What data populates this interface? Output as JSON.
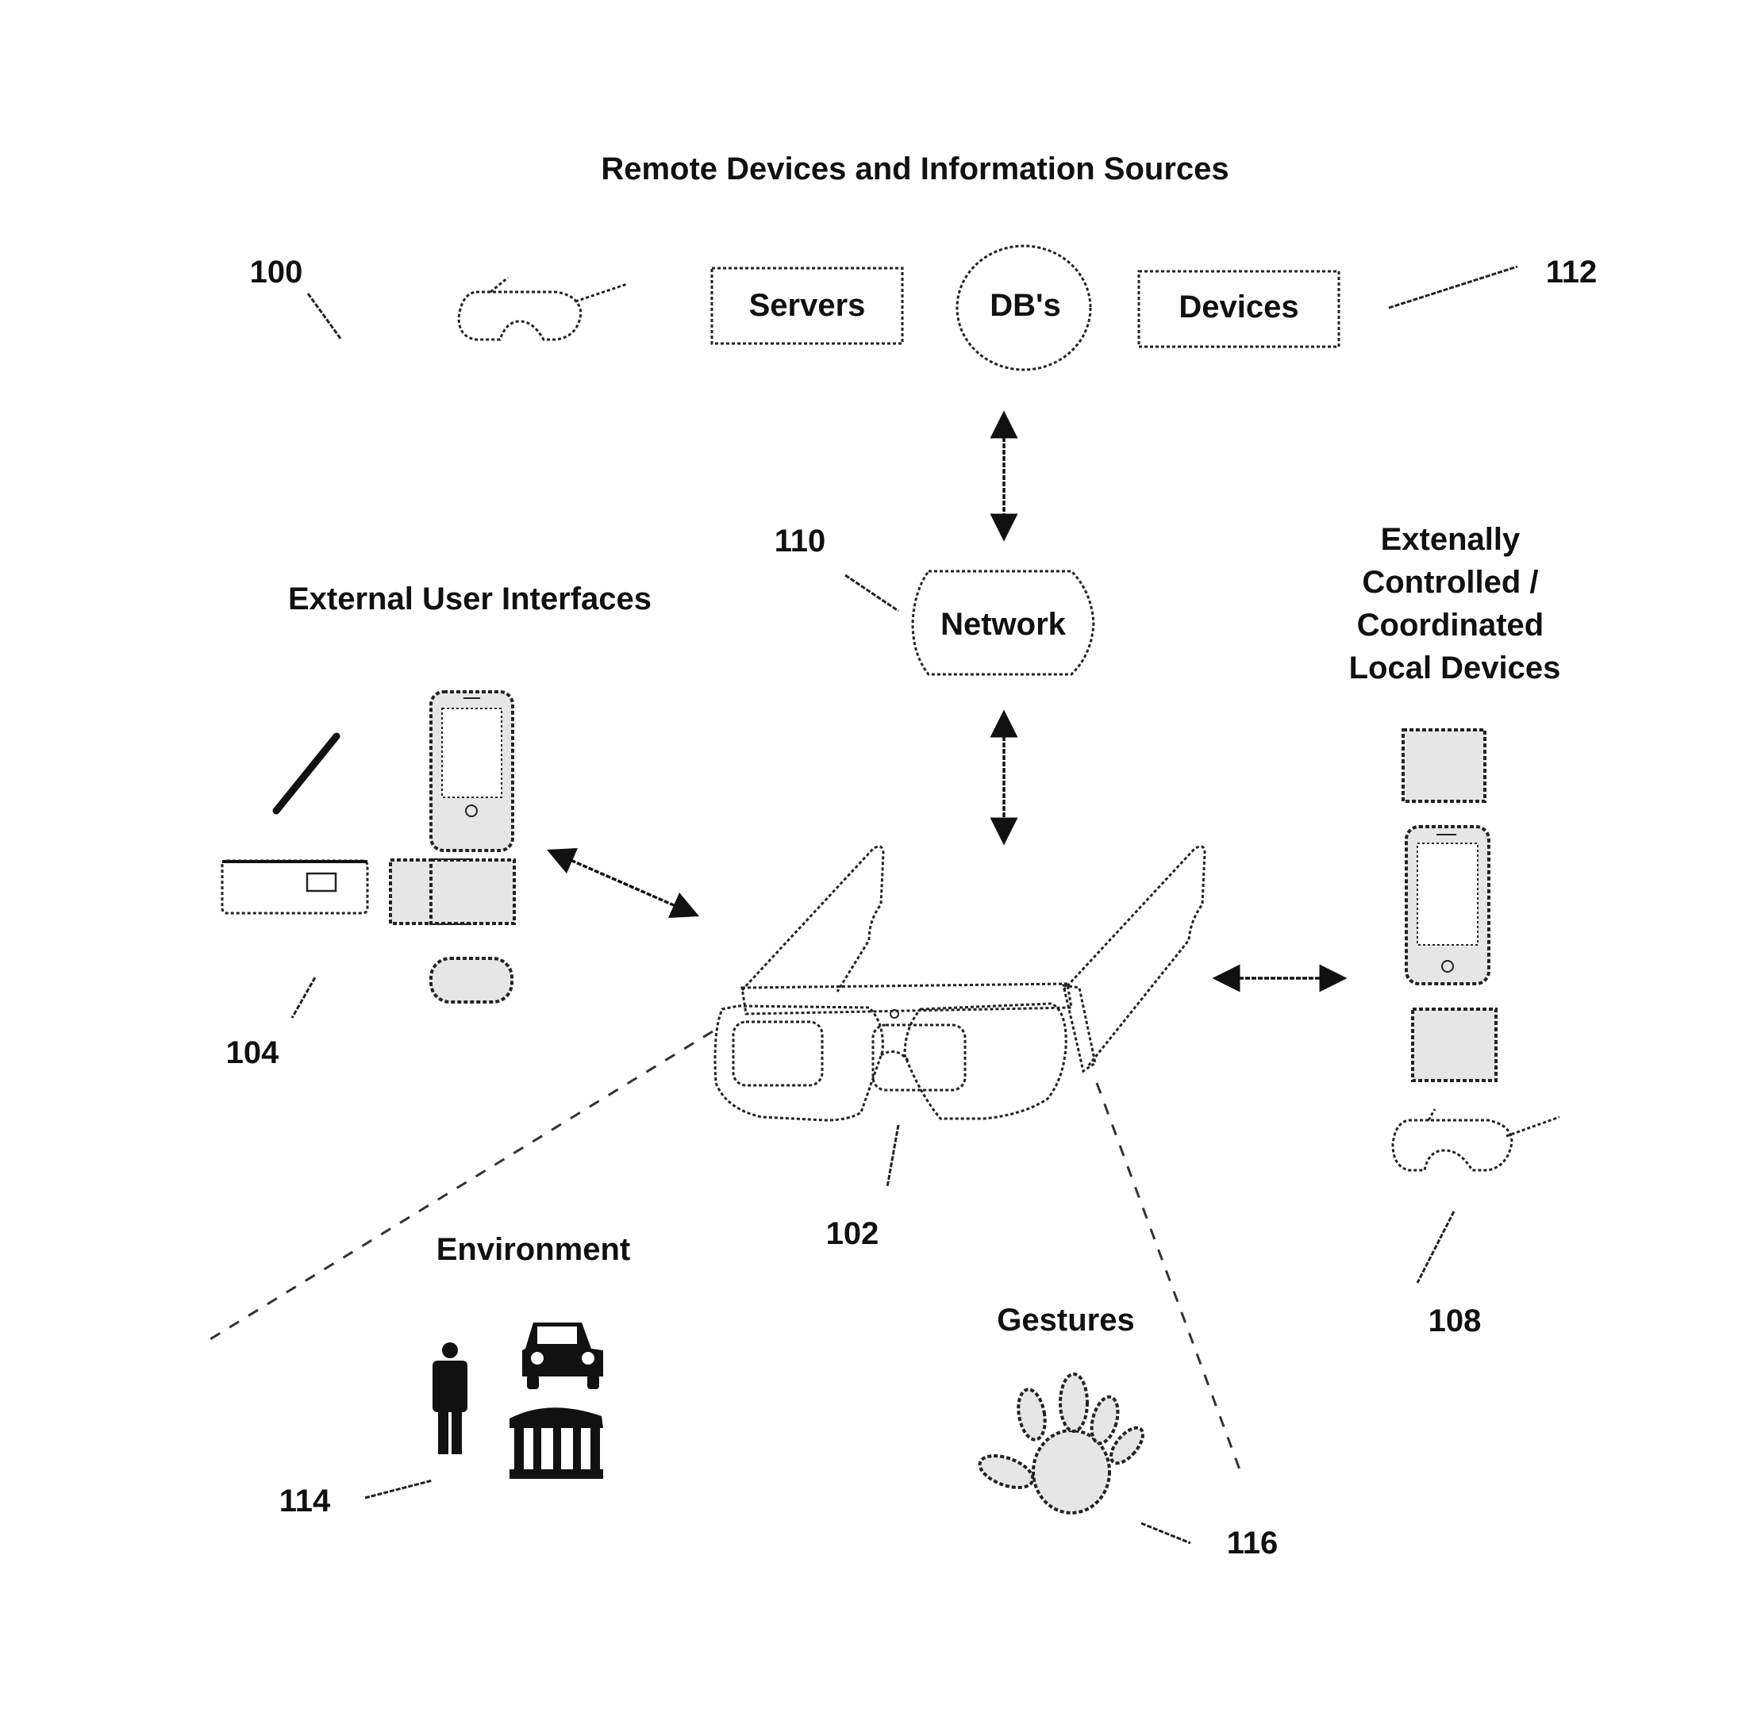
{
  "title": "Remote Devices and Information Sources",
  "remote": {
    "servers_label": "Servers",
    "dbs_label": "DB's",
    "devices_label": "Devices"
  },
  "network": {
    "label": "Network"
  },
  "sections": {
    "external_ui": "External User Interfaces",
    "local_devices": [
      "Extenally",
      "Controlled /",
      "Coordinated",
      "Local Devices"
    ],
    "environment": "Environment",
    "gestures": "Gestures"
  },
  "refs": {
    "r100": "100",
    "r102": "102",
    "r104": "104",
    "r108": "108",
    "r110": "110",
    "r112": "112",
    "r114": "114",
    "r116": "116"
  },
  "icons": {
    "remote_glasses": "glasses-icon",
    "stylus": "stylus-icon",
    "smartphone": "smartphone-icon",
    "keyboard": "keyboard-icon",
    "tablet": "tablet-icon",
    "mouse": "mouse-icon",
    "main_glasses": "smart-glasses-icon",
    "person": "person-icon",
    "car": "car-icon",
    "building": "building-icon",
    "hand": "hand-icon"
  }
}
